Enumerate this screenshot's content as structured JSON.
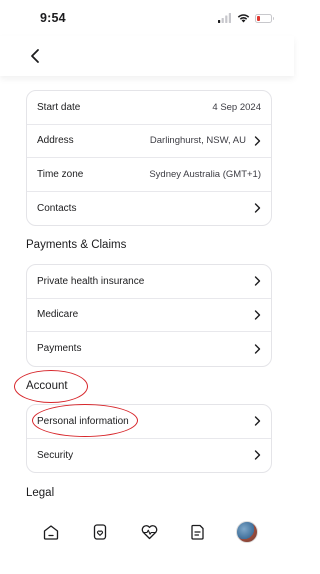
{
  "status_bar": {
    "time": "9:54",
    "battery_color": "#e0372f"
  },
  "header": {
    "back_icon": "chevron-left-icon"
  },
  "profile_group": {
    "rows": [
      {
        "label": "Start date",
        "value": "4 Sep 2024",
        "has_chevron": false
      },
      {
        "label": "Address",
        "value": "Darlinghurst, NSW, AU",
        "has_chevron": true
      },
      {
        "label": "Time zone",
        "value": "Sydney Australia (GMT+1)",
        "has_chevron": false
      },
      {
        "label": "Contacts",
        "value": "",
        "has_chevron": true
      }
    ]
  },
  "payments_section": {
    "title": "Payments & Claims",
    "rows": [
      {
        "label": "Private health insurance"
      },
      {
        "label": "Medicare"
      },
      {
        "label": "Payments"
      }
    ]
  },
  "account_section": {
    "title": "Account",
    "rows": [
      {
        "label": "Personal information"
      },
      {
        "label": "Security"
      }
    ]
  },
  "legal_section": {
    "title": "Legal"
  },
  "annotation_color": "#d7262b",
  "tab_bar": {
    "tabs": [
      "home-icon",
      "device-heart-icon",
      "heart-pulse-icon",
      "document-icon",
      "profile-avatar"
    ]
  }
}
